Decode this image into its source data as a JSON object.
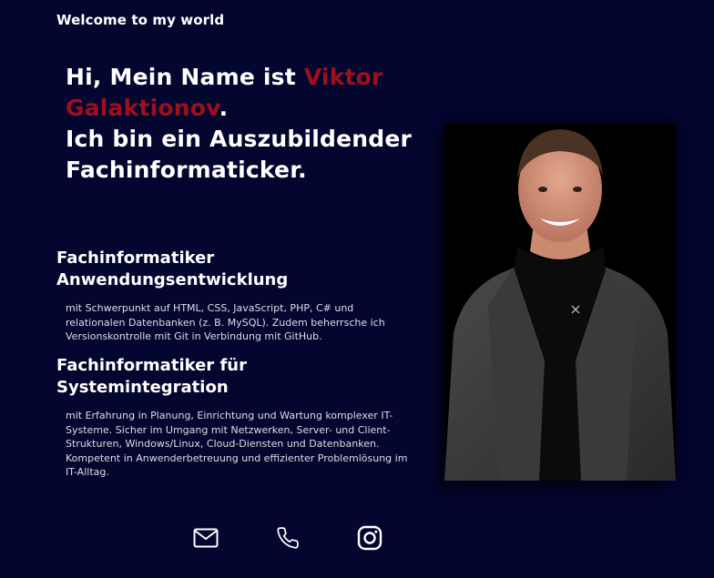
{
  "header": {
    "welcome": "Welcome to my world"
  },
  "hero": {
    "intro": "Hi, Mein Name ist ",
    "name": "Viktor Galaktionov",
    "period": ".",
    "line2": "Ich bin ein Auszubildender Fachinformaticker."
  },
  "sections": [
    {
      "title": "Fachinformatiker Anwendungsentwicklung",
      "text": "mit Schwerpunkt auf HTML, CSS, JavaScript, PHP, C# und relationalen Datenbanken (z. B. MySQL). Zudem beherrsche ich Versionskontrolle mit Git in Verbindung mit GitHub."
    },
    {
      "title": "Fachinformatiker für Systemintegration",
      "text": "mit Erfahrung in Planung, Einrichtung und Wartung komplexer IT-Systeme. Sicher im Umgang mit Netzwerken, Server- und Client-Strukturen, Windows/Linux, Cloud-Diensten und Datenbanken. Kompetent in Anwenderbetreuung und effizienter Problemlösung im IT-Alltag."
    }
  ],
  "social": {
    "icons": [
      "mail-icon",
      "phone-icon",
      "instagram-icon"
    ]
  },
  "colors": {
    "background": "#03062e",
    "accent": "#9e0f1d",
    "text": "#ffffff"
  }
}
